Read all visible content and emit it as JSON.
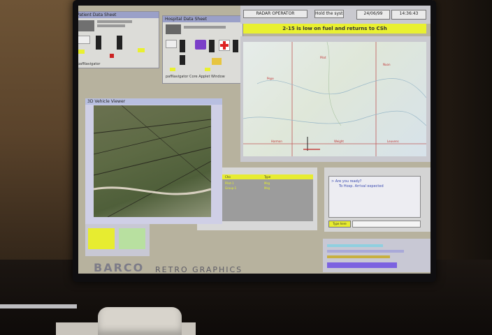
{
  "monitor": {
    "brand": "BARCO",
    "model": "RETRO GRAPHICS"
  },
  "windows": {
    "patient1": {
      "title": "Patient Data Sheet",
      "caption": "pafNavigator",
      "icons": [
        "camera-icon",
        "gear-icon"
      ]
    },
    "patient2": {
      "title": "Hospital Data Sheet",
      "caption": "pafNavigator Core Applet Window",
      "icons": [
        "map-pin-icon",
        "red-cross-icon",
        "star-icon"
      ]
    },
    "terrain": {
      "title": "3D Vehicle Viewer"
    },
    "top": {
      "left_label": "RADAR OPERATOR",
      "button": "Hold the system",
      "date": "24/06/99",
      "time": "14:36:43"
    },
    "alert": {
      "text": "2-15 is low on fuel and returns to CSh"
    },
    "map": {
      "labels": [
        "Pepe",
        "Pilot",
        "Nuon",
        "Harmon",
        "Weight",
        "Leuvens"
      ]
    },
    "list": {
      "headers": [
        "Cho",
        "Type"
      ],
      "rows": [
        [
          "Pilot-1",
          "Msg"
        ],
        [
          "Group-1",
          "Msg"
        ]
      ]
    },
    "chat": {
      "lines": [
        "> Are you ready?",
        "To Hosp. Arrival expected"
      ],
      "button": "Type here"
    }
  },
  "colors": {
    "alert": "#e9f030",
    "window": "#dcdcd8",
    "titlebar": "#9aa0c8"
  }
}
